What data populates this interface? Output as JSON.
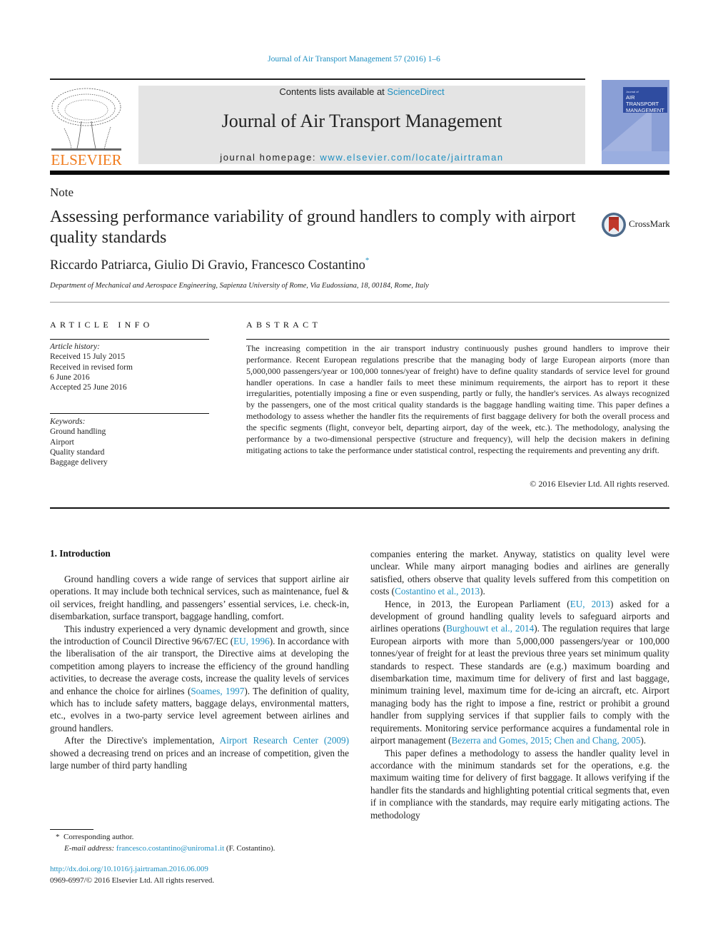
{
  "running_header": "Journal of Air Transport Management 57 (2016) 1–6",
  "masthead": {
    "publisher_logo_text": "ELSEVIER",
    "contents_prefix": "Contents lists available at ",
    "contents_link": "ScienceDirect",
    "journal_title": "Journal of Air Transport Management",
    "homepage_prefix": "journal homepage: ",
    "homepage_link": "www.elsevier.com/locate/jairtraman",
    "cover_small_text": "Journal of",
    "cover_title": "AIR TRANSPORT MANAGEMENT"
  },
  "article": {
    "type_label": "Note",
    "title": "Assessing performance variability of ground handlers to comply with airport quality standards",
    "crossmark_label": "CrossMark",
    "authors": "Riccardo Patriarca, Giulio Di Gravio, Francesco Costantino",
    "corresponding_marker": "*",
    "affiliation": "Department of Mechanical and Aerospace Engineering, Sapienza University of Rome, Via Eudossiana, 18, 00184, Rome, Italy"
  },
  "article_info": {
    "heading": "ARTICLE INFO",
    "history_label": "Article history:",
    "history": [
      "Received 15 July 2015",
      "Received in revised form",
      "6 June 2016",
      "Accepted 25 June 2016"
    ],
    "keywords_label": "Keywords:",
    "keywords": [
      "Ground handling",
      "Airport",
      "Quality standard",
      "Baggage delivery"
    ]
  },
  "abstract": {
    "heading": "ABSTRACT",
    "text": "The increasing competition in the air transport industry continuously pushes ground handlers to improve their performance. Recent European regulations prescribe that the managing body of large European airports (more than 5,000,000 passengers/year or 100,000 tonnes/year of freight) have to define quality standards of service level for ground handler operations. In case a handler fails to meet these minimum requirements, the airport has to report it these irregularities, potentially imposing a fine or even suspending, partly or fully, the handler's services. As always recognized by the passengers, one of the most critical quality standards is the baggage handling waiting time. This paper defines a method­ology to assess whether the handler fits the requirements of first baggage delivery for both the overall process and the specific segments (flight, conveyor belt, departing airport, day of the week, etc.). The methodology, analysing the performance by a two-dimensional perspective (structure and frequency), will help the decision makers in defining mitigating actions to take the performance under statistical control, respecting the requirements and preventing any drift.",
    "copyright": "© 2016 Elsevier Ltd. All rights reserved."
  },
  "body": {
    "section_heading": "1.  Introduction",
    "left_paragraphs": [
      {
        "parts": [
          {
            "t": "Ground handling covers a wide range of services that support airline air operations. It may include both technical services, such as maintenance, fuel & oil services, freight handling, and passengers’ essential services, i.e. check-in, disembarkation, surface transport, baggage handling, comfort."
          }
        ]
      },
      {
        "parts": [
          {
            "t": "This industry experienced a very dynamic development and growth, since the introduction of Council Directive 96/67/EC ("
          },
          {
            "t": "EU, 1996",
            "link": true
          },
          {
            "t": "). In accordance with the liberalisation of the air transport, the Directive aims at developing the competition among players to increase the efficiency of the ground handling activities, to decrease the average costs, increase the quality levels of services and enhance the choice for airlines ("
          },
          {
            "t": "Soames, 1997",
            "link": true
          },
          {
            "t": "). The definition of quality, which has to include safety matters, baggage delays, envi­ronmental matters, etc., evolves in a two-party service level agreement between airlines and ground handlers."
          }
        ]
      },
      {
        "parts": [
          {
            "t": "After the Directive's implementation, "
          },
          {
            "t": "Airport Research Center (2009)",
            "link": true
          },
          {
            "t": " showed a decreasing trend on prices and an increase of competition, given the large number of third party handling"
          }
        ]
      }
    ],
    "right_paragraphs": [
      {
        "continued": true,
        "parts": [
          {
            "t": "companies entering the market. Anyway, statistics on quality level were unclear. While many airport managing bodies and airlines are generally satisfied, others observe that quality levels suffered from this competition on costs ("
          },
          {
            "t": "Costantino et al., 2013",
            "link": true
          },
          {
            "t": ")."
          }
        ]
      },
      {
        "parts": [
          {
            "t": "Hence, in 2013, the European Parliament ("
          },
          {
            "t": "EU, 2013",
            "link": true
          },
          {
            "t": ") asked for a development of ground handling quality levels to safeguard air­ports and airlines operations ("
          },
          {
            "t": "Burghouwt et al., 2014",
            "link": true
          },
          {
            "t": "). The regula­tion requires that large European airports with more than 5,000,000 passengers/year or 100,000 tonnes/year of freight for at least the previous three years set minimum quality standards to respect. These standards are (e.g.) maximum boarding and disembarkation time, maximum time for delivery of first and last baggage, minimum training level, maximum time for de-icing an aircraft, etc. Airport managing body has the right to impose a fine, restrict or prohibit a ground handler from supplying services if that supplier fails to comply with the requirements. Monitoring service performance acquires a fundamental role in airport management ("
          },
          {
            "t": "Bezerra and Gomes, 2015; Chen and Chang, 2005",
            "link": true
          },
          {
            "t": ")."
          }
        ]
      },
      {
        "parts": [
          {
            "t": "This paper defines a methodology to assess the handler quality level in accordance with the minimum standards set for the oper­ations, e.g. the maximum waiting time for delivery of first baggage. It allows verifying if the handler fits the standards and highlighting potential critical segments that, even if in compliance with the standards, may require early mitigating actions. The methodology"
          }
        ]
      }
    ]
  },
  "footnote": {
    "marker": "*",
    "corresponding": "Corresponding author.",
    "email_label": "E-mail address:",
    "email": "francesco.costantino@uniroma1.it",
    "email_suffix": " (F. Costantino)."
  },
  "doi": {
    "url": "http://dx.doi.org/10.1016/j.jairtraman.2016.06.009",
    "issn_line": "0969-6997/© 2016 Elsevier Ltd. All rights reserved."
  }
}
